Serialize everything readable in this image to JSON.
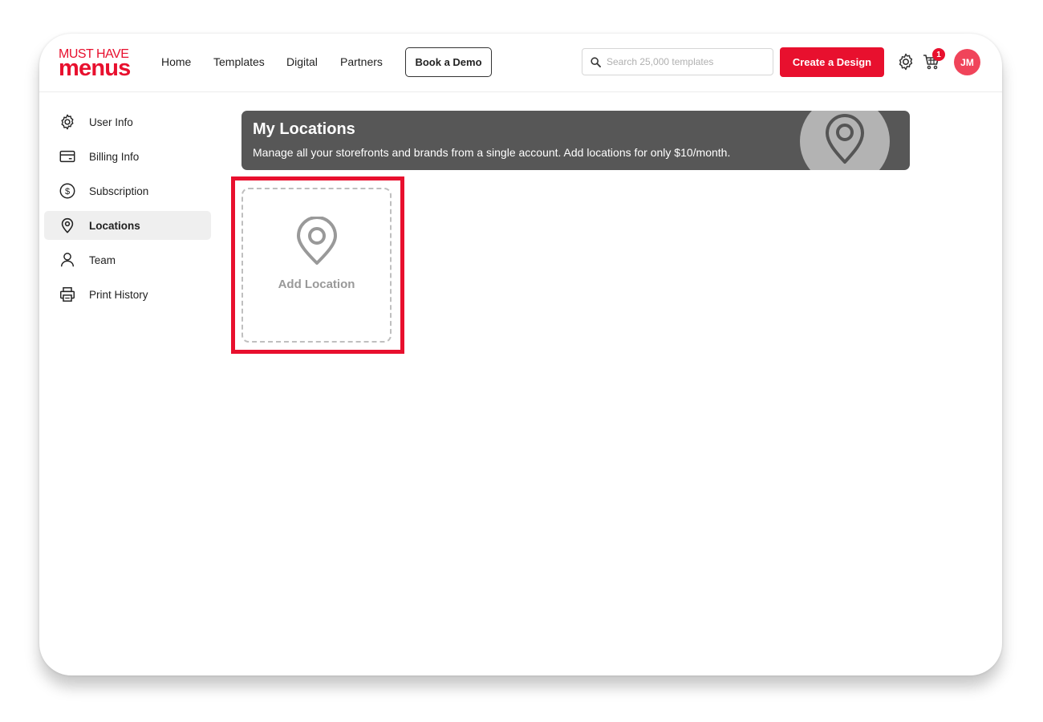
{
  "header": {
    "logo_top": "MUST HAVE",
    "logo_bottom": "menus",
    "nav": [
      "Home",
      "Templates",
      "Digital",
      "Partners"
    ],
    "demo_label": "Book a Demo",
    "search_placeholder": "Search 25,000 templates",
    "create_label": "Create a Design",
    "cart_count": "1",
    "avatar_initials": "JM"
  },
  "sidebar": {
    "items": [
      {
        "label": "User Info",
        "icon": "gear-icon"
      },
      {
        "label": "Billing Info",
        "icon": "card-icon"
      },
      {
        "label": "Subscription",
        "icon": "dollar-icon"
      },
      {
        "label": "Locations",
        "icon": "location-pin-icon",
        "active": true
      },
      {
        "label": "Team",
        "icon": "person-icon"
      },
      {
        "label": "Print History",
        "icon": "printer-icon"
      }
    ]
  },
  "banner": {
    "title": "My Locations",
    "subtitle": "Manage all your storefronts and brands from a single account. Add locations for only $10/month."
  },
  "add_location": {
    "label": "Add Location"
  },
  "colors": {
    "brand_red": "#e8102e",
    "banner_bg": "#575757",
    "highlight": "#e8102e"
  }
}
